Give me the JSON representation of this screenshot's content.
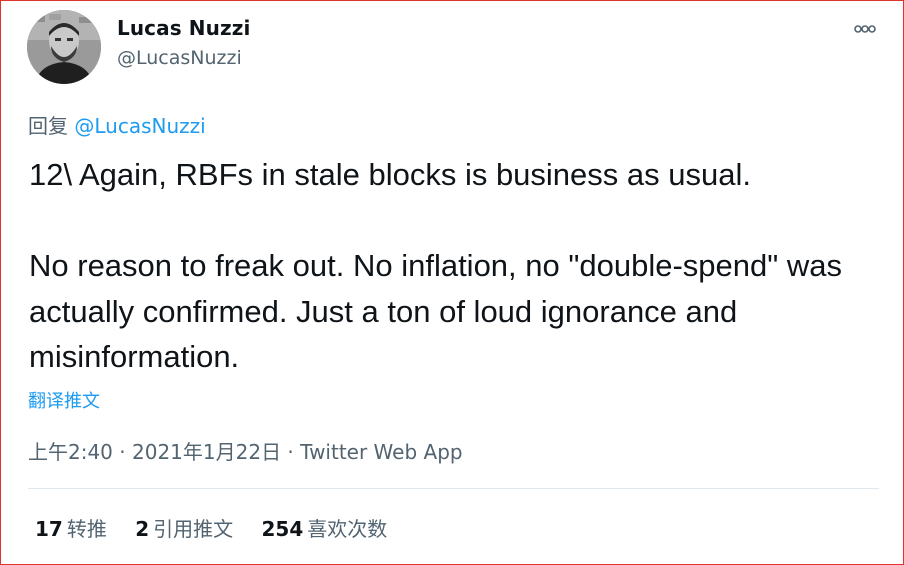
{
  "author": {
    "display_name": "Lucas Nuzzi",
    "handle": "@LucasNuzzi"
  },
  "reply_to": {
    "prefix": "回复",
    "mention": "@LucasNuzzi"
  },
  "tweet": {
    "text": "12\\ Again, RBFs in stale blocks is business as usual.\n\nNo reason to freak out. No inflation, no \"double-spend\" was actually confirmed. Just a ton of loud ignorance and misinformation."
  },
  "translate_label": "翻译推文",
  "meta": {
    "time": "上午2:40",
    "separator": " · ",
    "date": "2021年1月22日",
    "source": "Twitter Web App"
  },
  "stats": {
    "retweets": {
      "count": "17",
      "label": "转推"
    },
    "quotes": {
      "count": "2",
      "label": "引用推文"
    },
    "likes": {
      "count": "254",
      "label": "喜欢次数"
    }
  },
  "icons": {
    "more": "more-horizontal-icon",
    "avatar": "profile-photo"
  },
  "colors": {
    "accent": "#1d9bf0",
    "secondary_text": "#536471",
    "primary_text": "#0f1419",
    "frame_border": "#e0332e"
  }
}
